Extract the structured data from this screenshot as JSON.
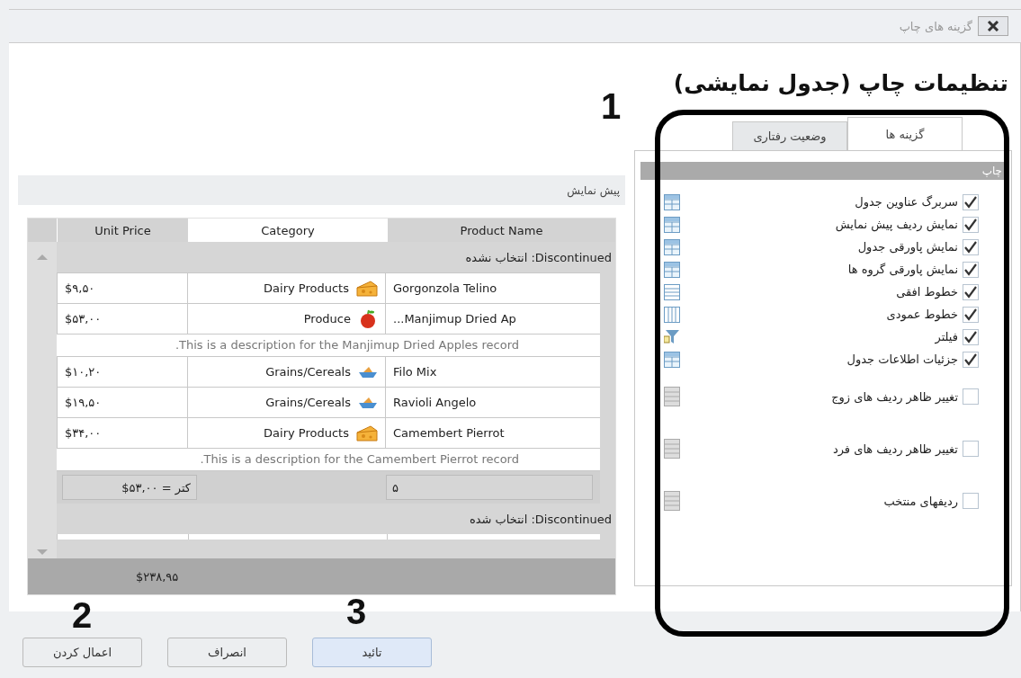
{
  "window": {
    "title": "گزینه های چاپ"
  },
  "heading": "تنظیمات چاپ (جدول نمایشی)",
  "tabs": [
    {
      "label": "گزینه ها",
      "selected": true
    },
    {
      "label": "وضعیت رفتاری",
      "selected": false
    }
  ],
  "section": "چاپ",
  "options": [
    {
      "label": "سربرگ عناوین جدول",
      "checked": true,
      "kind": "table"
    },
    {
      "label": "نمایش ردیف پیش نمایش",
      "checked": true,
      "kind": "table"
    },
    {
      "label": "نمایش پاورقی جدول",
      "checked": true,
      "kind": "table"
    },
    {
      "label": "نمایش پاورقی گروه ها",
      "checked": true,
      "kind": "table"
    },
    {
      "label": "خطوط افقی",
      "checked": true,
      "kind": "lines-h"
    },
    {
      "label": "خطوط عمودی",
      "checked": true,
      "kind": "lines-v"
    },
    {
      "label": "فیلتر",
      "checked": true,
      "kind": "filter"
    },
    {
      "label": "جزئیات اطلاعات جدول",
      "checked": true,
      "kind": "table"
    },
    {
      "label": "تغییر ظاهر ردیف های زوج",
      "checked": false,
      "kind": "row-style"
    },
    {
      "label": "تغییر ظاهر ردیف های فرد",
      "checked": false,
      "kind": "row-style"
    },
    {
      "label": "ردیفهای منتخب",
      "checked": false,
      "kind": "row-style"
    }
  ],
  "preview": {
    "title": "پیش نمایش",
    "columns": [
      {
        "label": "Product Name",
        "selected": false
      },
      {
        "label": "Category",
        "selected": true
      },
      {
        "label": "Unit Price",
        "selected": false
      }
    ],
    "groups": [
      {
        "header": "Discontinued: انتخاب نشده",
        "rows": [
          {
            "kind": "cheese",
            "price": "$۹,۵۰",
            "category": "Dairy Products",
            "product": "Gorgonzola Telino"
          },
          {
            "kind": "apple",
            "price": "$۵۳,۰۰",
            "category": "Produce",
            "product": "Manjimup Dried Ap..."
          },
          {
            "kind": "description",
            "text": "This is a description for the Manjimup Dried Apples record."
          },
          {
            "kind": "bowl",
            "price": "$۱۰,۲۰",
            "category": "Grains/Cereals",
            "product": "Filo Mix"
          },
          {
            "kind": "bowl",
            "price": "$۱۹,۵۰",
            "category": "Grains/Cereals",
            "product": "Ravioli Angelo"
          },
          {
            "kind": "cheese",
            "price": "$۳۴,۰۰",
            "category": "Dairy Products",
            "product": "Camembert Pierrot"
          },
          {
            "kind": "description",
            "text": "This is a description for the Camembert Pierrot record."
          },
          {
            "kind": "footer",
            "price": "کتر = ۵۳,۰۰$",
            "product": "۵"
          }
        ]
      },
      {
        "header": "Discontinued: انتخاب شده"
      }
    ],
    "total": "$۲۳۸,۹۵"
  },
  "buttons": [
    {
      "label": "تائید",
      "default": true
    },
    {
      "label": "انصراف",
      "default": false
    },
    {
      "label": "اعمال کردن",
      "default": false
    }
  ],
  "annotations": [
    "1",
    "2",
    "3"
  ]
}
